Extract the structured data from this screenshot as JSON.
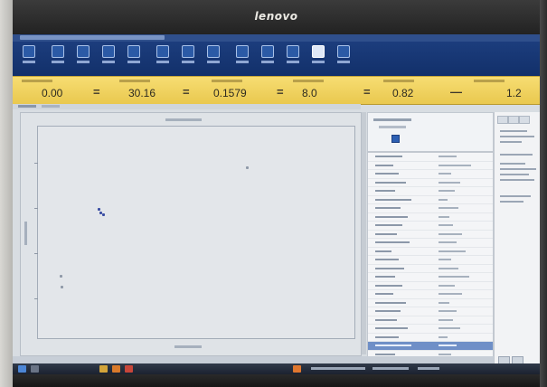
{
  "monitor": {
    "brand": "lenovo"
  },
  "readouts": [
    {
      "value": "0.00"
    },
    {
      "value": "30.16"
    },
    {
      "value": "0.1579"
    },
    {
      "value": "8.0"
    },
    {
      "value": "0.82"
    },
    {
      "value": "1.2"
    }
  ],
  "operators": [
    "=",
    "=",
    "=",
    "=",
    "—",
    "—"
  ],
  "colors": {
    "ribbon": "#12306a",
    "readout_bar": "#f0d35f",
    "selection": "#6f8fc7",
    "plot_points": "#3a4ea3"
  }
}
